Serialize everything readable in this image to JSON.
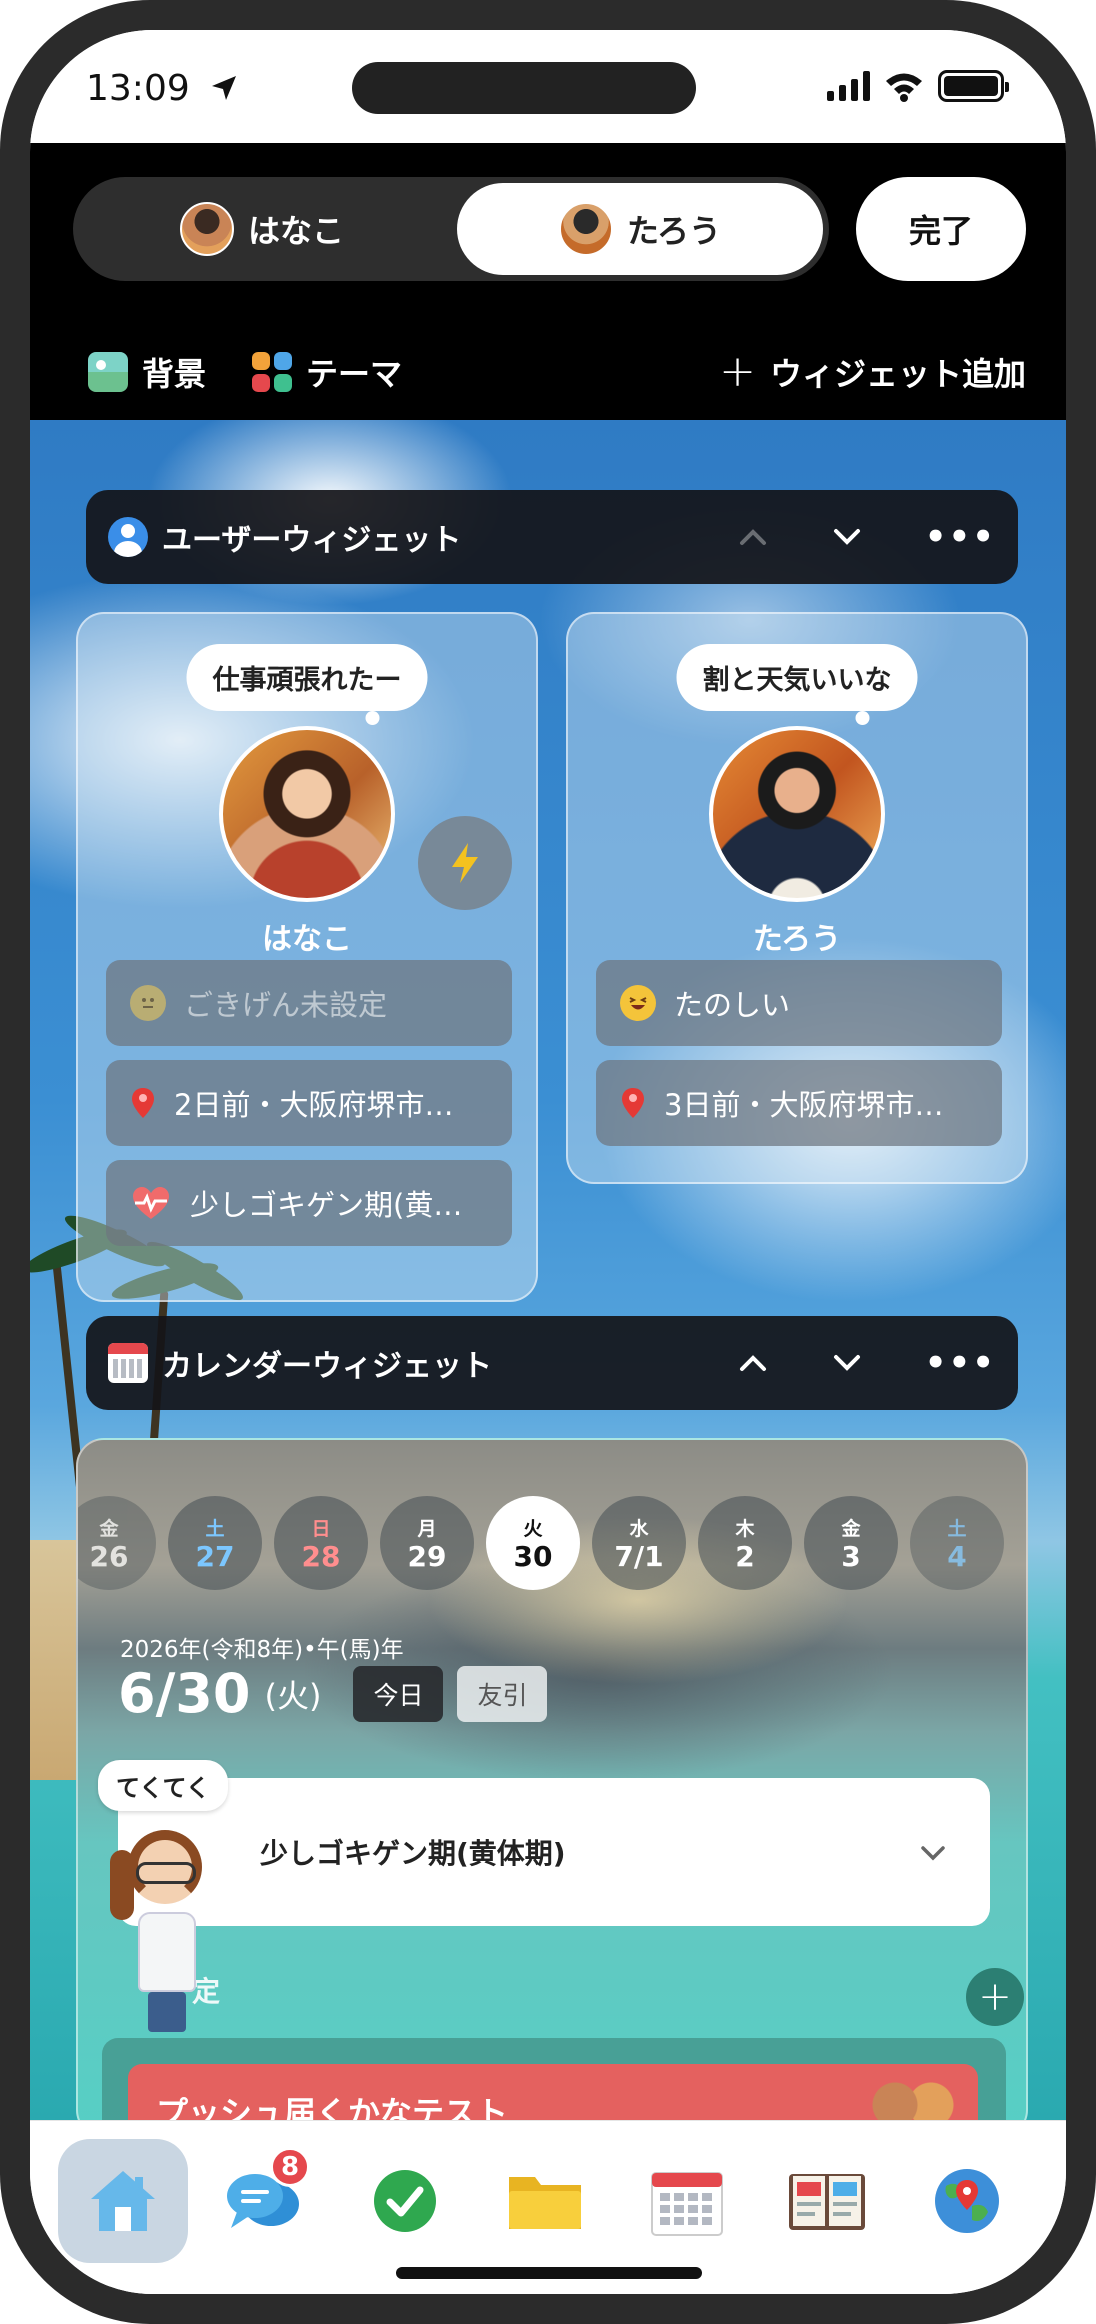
{
  "status_bar": {
    "time": "13:09"
  },
  "header": {
    "segments": [
      {
        "label": "はなこ",
        "selected": false
      },
      {
        "label": "たろう",
        "selected": true
      }
    ],
    "done_label": "完了",
    "tools": {
      "background_label": "背景",
      "theme_label": "テーマ",
      "add_widget_label": "ウィジェット追加"
    }
  },
  "user_widget": {
    "title": "ユーザーウィジェット",
    "users": [
      {
        "name": "はなこ",
        "bubble": "仕事頑張れたー",
        "mood": "ごきげん未設定",
        "location": "2日前・大阪府堺市…",
        "cycle": "少しゴキゲン期(黄…"
      },
      {
        "name": "たろう",
        "bubble": "割と天気いいな",
        "mood": "たのしい",
        "location": "3日前・大阪府堺市…"
      }
    ]
  },
  "calendar_widget": {
    "title": "カレンダーウィジェット",
    "days": [
      {
        "weekday": "金",
        "day": "26",
        "kind": "fade"
      },
      {
        "weekday": "土",
        "day": "27",
        "kind": "sat"
      },
      {
        "weekday": "日",
        "day": "28",
        "kind": "sun"
      },
      {
        "weekday": "月",
        "day": "29",
        "kind": ""
      },
      {
        "weekday": "火",
        "day": "30",
        "kind": "today"
      },
      {
        "weekday": "水",
        "day": "7/1",
        "kind": ""
      },
      {
        "weekday": "木",
        "day": "2",
        "kind": ""
      },
      {
        "weekday": "金",
        "day": "3",
        "kind": ""
      },
      {
        "weekday": "土",
        "day": "4",
        "kind": "sat fade"
      }
    ],
    "era_label": "2026年(令和8年)•午(馬)年",
    "date": "6/30",
    "weekday": "(火)",
    "today_chip": "今日",
    "rokuyo_chip": "友引",
    "event_title": "少しゴキゲン期(黄体期)",
    "character_tag": "てくてく",
    "partial_label": "定",
    "notification_title": "プッシュ届くかなテスト"
  },
  "tab_bar": {
    "items": [
      "home",
      "chat",
      "tasks",
      "files",
      "calendar",
      "diary",
      "map"
    ],
    "chat_badge": "8"
  },
  "colors": {
    "accent_red": "#e5484d",
    "notification_red": "#e4615f",
    "teal_button": "#2c7f73"
  }
}
